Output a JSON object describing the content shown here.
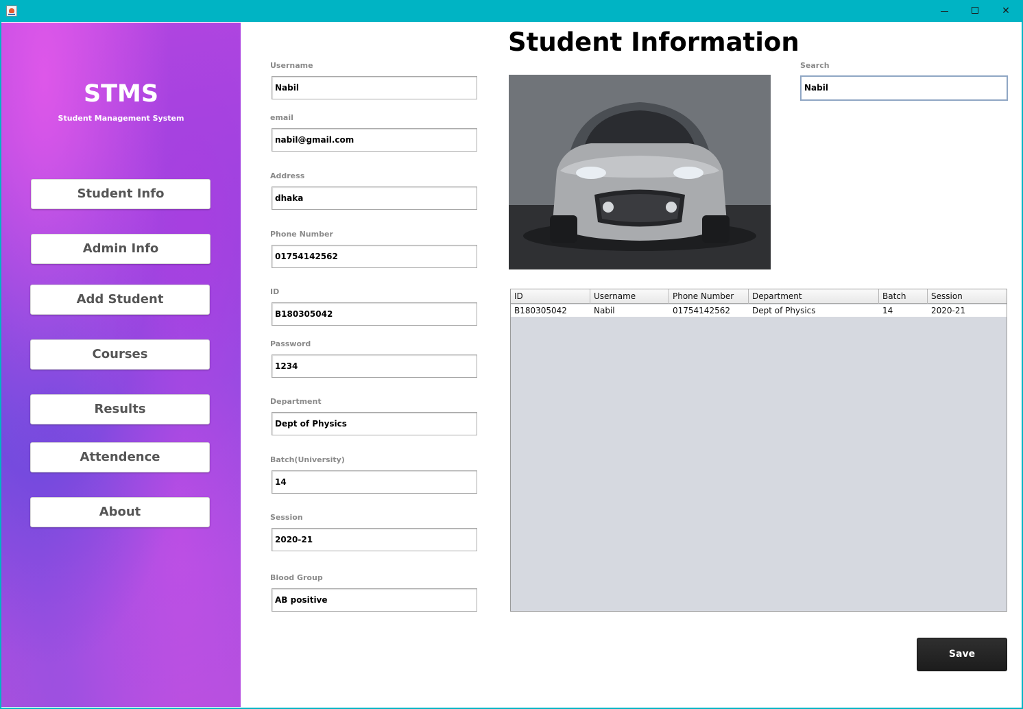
{
  "window": {
    "minimize_label": "",
    "maximize_label": "",
    "close_label": "✕"
  },
  "sidebar": {
    "title": "STMS",
    "subtitle": "Student Management System",
    "items": [
      {
        "label": "Student Info"
      },
      {
        "label": "Admin Info"
      },
      {
        "label": "Add Student"
      },
      {
        "label": "Courses"
      },
      {
        "label": "Results"
      },
      {
        "label": "Attendence"
      },
      {
        "label": "About"
      }
    ]
  },
  "page": {
    "title": "Student Information"
  },
  "form": {
    "username": {
      "label": "Username",
      "value": "Nabil"
    },
    "email": {
      "label": "email",
      "value": "nabil@gmail.com"
    },
    "address": {
      "label": "Address",
      "value": "dhaka"
    },
    "phone": {
      "label": "Phone Number",
      "value": "01754142562"
    },
    "id": {
      "label": "ID",
      "value": "B180305042"
    },
    "password": {
      "label": "Password",
      "value": "1234"
    },
    "department": {
      "label": "Department",
      "value": "Dept of Physics"
    },
    "batch": {
      "label": "Batch(University)",
      "value": "14"
    },
    "session": {
      "label": "Session",
      "value": "2020-21"
    },
    "blood_group": {
      "label": "Blood Group",
      "value": "AB positive"
    }
  },
  "search": {
    "label": "Search",
    "value": "Nabil"
  },
  "table": {
    "columns": [
      "ID",
      "Username",
      "Phone Number",
      "Department",
      "Batch",
      "Session"
    ],
    "rows": [
      [
        "B180305042",
        "Nabil",
        "01754142562",
        "Dept of Physics",
        "14",
        "2020-21"
      ]
    ]
  },
  "actions": {
    "save_label": "Save"
  },
  "colors": {
    "titlebar": "#00b4c4",
    "sidebar_purple": "#9346de",
    "table_background": "#d6d9e0",
    "save_button": "#1c1c1c"
  },
  "icons": {
    "app": "java-app-icon",
    "minimize": "minimize-icon",
    "maximize": "maximize-icon",
    "close": "close-icon"
  }
}
